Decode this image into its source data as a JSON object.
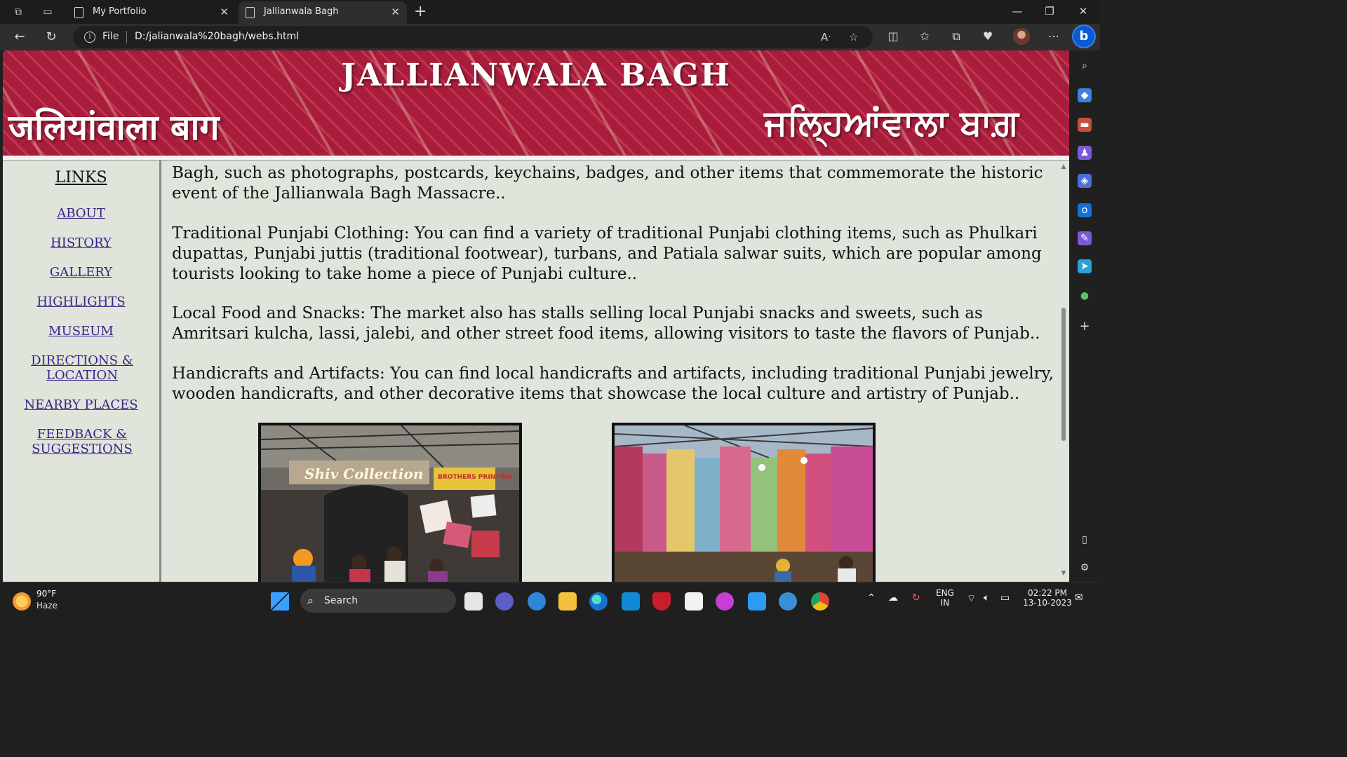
{
  "browser": {
    "tabs": [
      {
        "title": "My Portfolio",
        "active": false
      },
      {
        "title": "Jallianwala Bagh",
        "active": true
      }
    ],
    "address": {
      "scheme_label": "File",
      "url": "D:/jalianwala%20bagh/webs.html"
    }
  },
  "page": {
    "banner": {
      "title": "JALLIANWALA BAGH",
      "hindi": "जलियांवाला बाग",
      "punjabi": "ਜਲ੍ਹਿਆਂਵਾਲਾ ਬਾਗ਼"
    },
    "nav": {
      "heading": "LINKS",
      "links": [
        {
          "label": "ABOUT"
        },
        {
          "label": "HISTORY"
        },
        {
          "label": "GALLERY"
        },
        {
          "label": "HIGHLIGHTS"
        },
        {
          "label": "MUSEUM"
        },
        {
          "label": "DIRECTIONS & LOCATION"
        },
        {
          "label": "NEARBY PLACES"
        },
        {
          "label": "FEEDBACK & SUGGESTIONS"
        }
      ]
    },
    "paragraphs": [
      "Bagh, such as photographs, postcards, keychains, badges, and other items that commemorate the historic event of the Jallianwala Bagh Massacre..",
      "Traditional Punjabi Clothing: You can find a variety of traditional Punjabi clothing items, such as Phulkari dupattas, Punjabi juttis (traditional footwear), turbans, and Patiala salwar suits, which are popular among tourists looking to take home a piece of Punjabi culture..",
      "Local Food and Snacks: The market also has stalls selling local Punjabi snacks and sweets, such as Amritsari kulcha, lassi, jalebi, and other street food items, allowing visitors to taste the flavors of Punjab..",
      "Handicrafts and Artifacts: You can find local handicrafts and artifacts, including traditional Punjabi jewelry, wooden handicrafts, and other decorative items that showcase the local culture and artistry of Punjab.."
    ],
    "photos": {
      "left_sign": "Shiv Collection",
      "left_sign2": "BROTHERS PRINTING"
    }
  },
  "taskbar": {
    "weather": {
      "temp": "90°F",
      "condition": "Haze"
    },
    "search_placeholder": "Search",
    "lang": {
      "line1": "ENG",
      "line2": "IN"
    },
    "clock": {
      "time": "02:22 PM",
      "date": "13-10-2023"
    }
  }
}
